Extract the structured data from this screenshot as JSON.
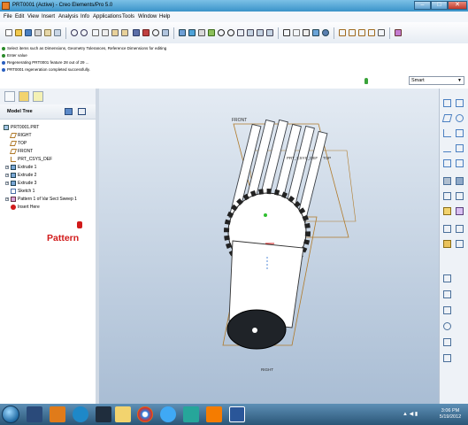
{
  "window": {
    "title": "PRT0001 (Active) - Creo Elements/Pro 5.0",
    "minimize": "–",
    "maximize": "□",
    "close": "✕"
  },
  "menu": {
    "items": [
      "File",
      "Edit",
      "View",
      "Insert",
      "Analysis",
      "Info",
      "Applications",
      "Tools",
      "Window",
      "Help"
    ]
  },
  "messages": [
    "Select items such as Dimensions, Geometry Tolerances, Reference Dimensions for editing",
    "Enter value",
    "Regenerating PRT0001 feature 28 out of 29 ...",
    "PRT0001 regeneration completed successfully."
  ],
  "filter": {
    "selected": "Smart"
  },
  "model_tree": {
    "header": "Model Tree",
    "items": [
      {
        "label": "PRT0001.PRT",
        "icon": "part-icon"
      },
      {
        "label": "RIGHT",
        "icon": "datum-plane-icon"
      },
      {
        "label": "TOP",
        "icon": "datum-plane-icon"
      },
      {
        "label": "FRONT",
        "icon": "datum-plane-icon"
      },
      {
        "label": "PRT_CSYS_DEF",
        "icon": "csys-icon"
      },
      {
        "label": "Extrude 1",
        "icon": "extrude-icon"
      },
      {
        "label": "Extrude 2",
        "icon": "extrude-icon"
      },
      {
        "label": "Extrude 3",
        "icon": "extrude-icon"
      },
      {
        "label": "Sketch 1",
        "icon": "sketch-icon"
      },
      {
        "label": "Pattern 1 of Var Sect Sweep 1",
        "icon": "pattern-icon"
      },
      {
        "label": "Insert Here",
        "icon": "insert-here-icon"
      }
    ]
  },
  "annotation": "Pattern",
  "viewport": {
    "labels": [
      "FRONT",
      "PRT_CSYS_DEF",
      "TOP",
      "RIGHT"
    ]
  },
  "taskbar": {
    "time": "3:06 PM",
    "date": "5/19/2012"
  },
  "colors": {
    "annotation": "#d11a1a",
    "datum": "#b07a2a",
    "model": "#ffffff"
  }
}
